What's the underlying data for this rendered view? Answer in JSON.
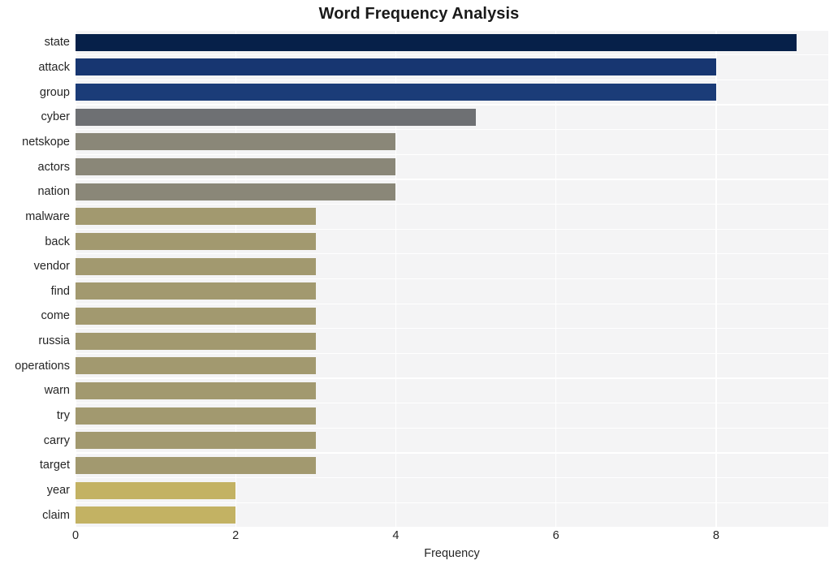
{
  "chart_data": {
    "type": "bar",
    "orientation": "horizontal",
    "title": "Word Frequency Analysis",
    "xlabel": "Frequency",
    "ylabel": "",
    "categories": [
      "state",
      "attack",
      "group",
      "cyber",
      "netskope",
      "actors",
      "nation",
      "malware",
      "back",
      "vendor",
      "find",
      "come",
      "russia",
      "operations",
      "warn",
      "try",
      "carry",
      "target",
      "year",
      "claim"
    ],
    "values": [
      9,
      8,
      8,
      5,
      4,
      4,
      4,
      3,
      3,
      3,
      3,
      3,
      3,
      3,
      3,
      3,
      3,
      3,
      2,
      2
    ],
    "bar_colors": [
      "#062049",
      "#173671",
      "#1b3c78",
      "#6e7073",
      "#8a8778",
      "#8a8778",
      "#8a8778",
      "#a2996f",
      "#a2996f",
      "#a2996f",
      "#a2996f",
      "#a2996f",
      "#a2996f",
      "#a2996f",
      "#a2996f",
      "#a2996f",
      "#a2996f",
      "#a2996f",
      "#c3b263",
      "#c3b263"
    ],
    "xlim": [
      0,
      9.4
    ],
    "xticks": [
      0,
      2,
      4,
      6,
      8
    ],
    "xtick_labels": [
      "0",
      "2",
      "4",
      "6",
      "8"
    ],
    "grid": true,
    "grid_color": "#ffffff",
    "plot_background": "#f4f4f5",
    "figure_background": "#ffffff",
    "legend": null,
    "style": "whitegrid"
  }
}
